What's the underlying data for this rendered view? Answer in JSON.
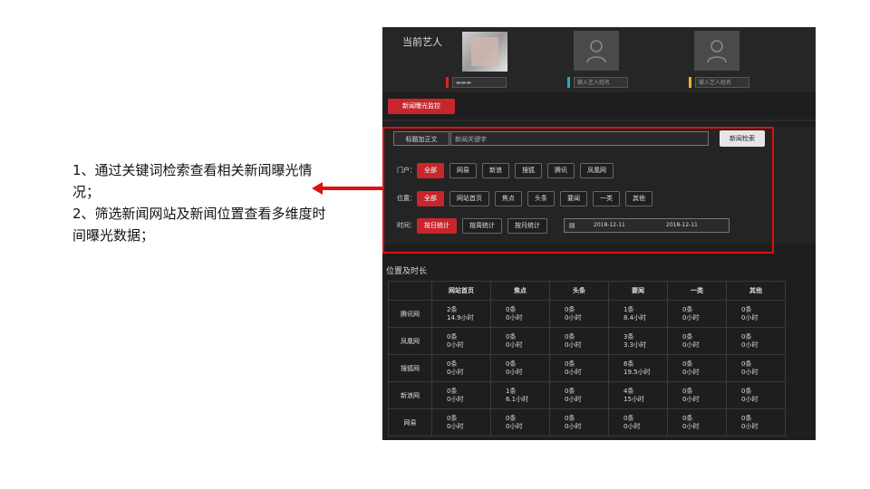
{
  "annotation": {
    "lines": [
      "1、通过关键词检索查看相关新闻曝光情况；",
      "2、筛选新闻网站及新闻位置查看多维度时间曝光数据；"
    ]
  },
  "artists": {
    "label": "当前艺人",
    "name_placeholder": "输入艺人姓名",
    "slots": [
      {
        "color": "#e02020",
        "value": "▬▬▬"
      },
      {
        "color": "#20a8e0",
        "value": ""
      },
      {
        "color": "#f0b020",
        "value": ""
      }
    ]
  },
  "nav": {
    "tab_label": "新闻曝光监控"
  },
  "search": {
    "scope_label": "标题加正文",
    "keyword_placeholder": "新闻关键字",
    "button_label": "新闻检索"
  },
  "filters": {
    "portal": {
      "label": "门户：",
      "options": [
        "全部",
        "网易",
        "新浪",
        "搜狐",
        "腾讯",
        "凤凰网"
      ],
      "active": 0
    },
    "position": {
      "label": "位置：",
      "options": [
        "全部",
        "网站首页",
        "焦点",
        "头条",
        "要闻",
        "一类",
        "其他"
      ],
      "active": 0
    },
    "time": {
      "label": "时间：",
      "options": [
        "按日统计",
        "按周统计",
        "按月统计"
      ],
      "active": 0,
      "start_date": "2018-12-11",
      "end_date": "2018-12-11"
    }
  },
  "table": {
    "title": "位置及时长",
    "columns": [
      "网站首页",
      "焦点",
      "头条",
      "要闻",
      "一类",
      "其他"
    ],
    "rows": [
      {
        "site": "腾讯网",
        "cells": [
          [
            "2条",
            "14.9小时"
          ],
          [
            "0条",
            "0小时"
          ],
          [
            "0条",
            "0小时"
          ],
          [
            "1条",
            "8.4小时"
          ],
          [
            "0条",
            "0小时"
          ],
          [
            "0条",
            "0小时"
          ]
        ]
      },
      {
        "site": "凤凰网",
        "cells": [
          [
            "0条",
            "0小时"
          ],
          [
            "0条",
            "0小时"
          ],
          [
            "0条",
            "0小时"
          ],
          [
            "3条",
            "3.3小时"
          ],
          [
            "0条",
            "0小时"
          ],
          [
            "0条",
            "0小时"
          ]
        ]
      },
      {
        "site": "搜狐网",
        "cells": [
          [
            "0条",
            "0小时"
          ],
          [
            "0条",
            "0小时"
          ],
          [
            "0条",
            "0小时"
          ],
          [
            "6条",
            "19.5小时"
          ],
          [
            "0条",
            "0小时"
          ],
          [
            "0条",
            "0小时"
          ]
        ]
      },
      {
        "site": "新浪网",
        "cells": [
          [
            "0条",
            "0小时"
          ],
          [
            "1条",
            "6.1小时"
          ],
          [
            "0条",
            "0小时"
          ],
          [
            "4条",
            "15小时"
          ],
          [
            "0条",
            "0小时"
          ],
          [
            "0条",
            "0小时"
          ]
        ]
      },
      {
        "site": "网易",
        "cells": [
          [
            "0条",
            "0小时"
          ],
          [
            "0条",
            "0小时"
          ],
          [
            "0条",
            "0小时"
          ],
          [
            "0条",
            "0小时"
          ],
          [
            "0条",
            "0小时"
          ],
          [
            "0条",
            "0小时"
          ]
        ]
      }
    ]
  },
  "colors": {
    "accent": "#c8262c",
    "callout": "#e01010",
    "panel_bg": "#1e1e1e"
  }
}
